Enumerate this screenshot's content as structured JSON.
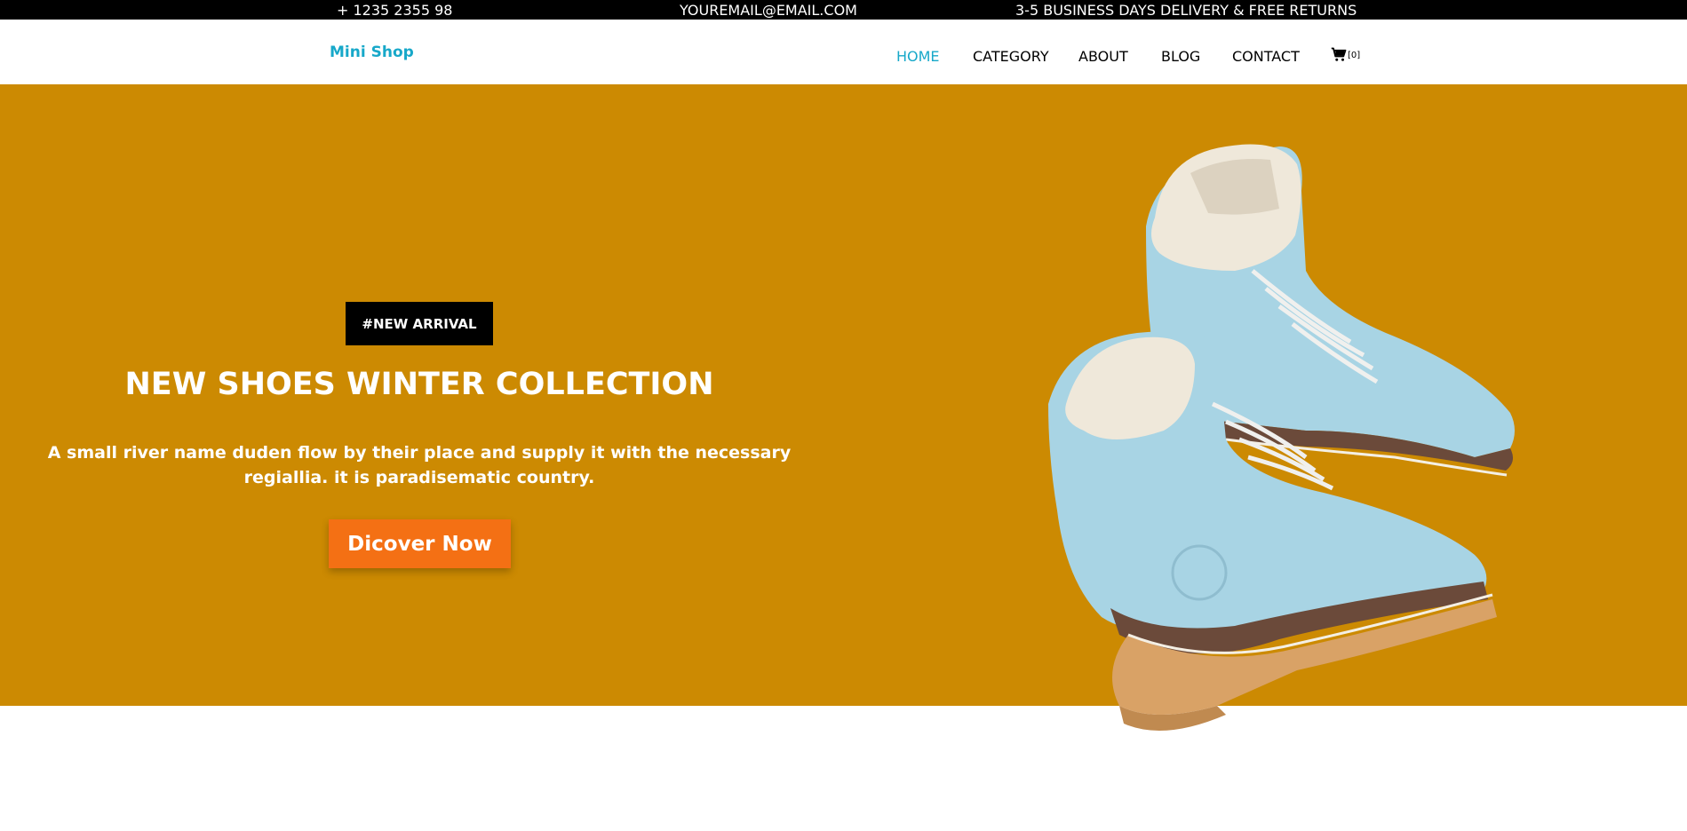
{
  "topbar": {
    "phone": "+ 1235 2355 98",
    "email": "YOUREMAIL@EMAIL.COM",
    "delivery": "3-5 BUSINESS DAYS DELIVERY & FREE RETURNS"
  },
  "nav": {
    "logo": "Mini Shop",
    "items": [
      {
        "label": "HOME",
        "active": true
      },
      {
        "label": "CATEGORY"
      },
      {
        "label": "ABOUT"
      },
      {
        "label": "BLOG"
      },
      {
        "label": "CONTACT"
      }
    ],
    "cart_icon": "cart-icon",
    "cart_count": "[0]"
  },
  "hero": {
    "badge": "#NEW ARRIVAL",
    "title": "NEW SHOES WINTER COLLECTION",
    "text": "A small river name duden flow by their place and supply it with the necessary regiallia. it is paradisematic country.",
    "cta": "Dicover Now",
    "image": "light-blue-winter-boots",
    "colors": {
      "background": "#cc8a02",
      "cta": "#f47014",
      "accent": "#17a8c9"
    }
  }
}
